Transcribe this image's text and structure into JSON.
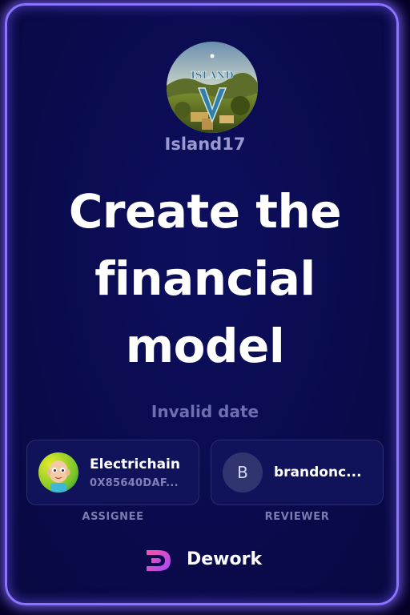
{
  "card": {
    "org_name": "Island17",
    "org_logo_text": "ISLAND",
    "title_lines": [
      "Create the",
      "financial",
      "model"
    ],
    "date": "Invalid date"
  },
  "assignee": {
    "name": "Electrichain",
    "address": "0X85640DAF...",
    "role_label": "ASSIGNEE",
    "avatar_icon": "cartoon-face-avatar"
  },
  "reviewer": {
    "initial": "B",
    "name": "brandonc...",
    "role_label": "REVIEWER"
  },
  "brand": {
    "name": "Dework",
    "icon": "dework-logo-icon"
  },
  "colors": {
    "card_border": "#8a73ff",
    "card_bg": "#0a0b4e",
    "title": "#ffffff",
    "muted": "#6e6fb0"
  }
}
